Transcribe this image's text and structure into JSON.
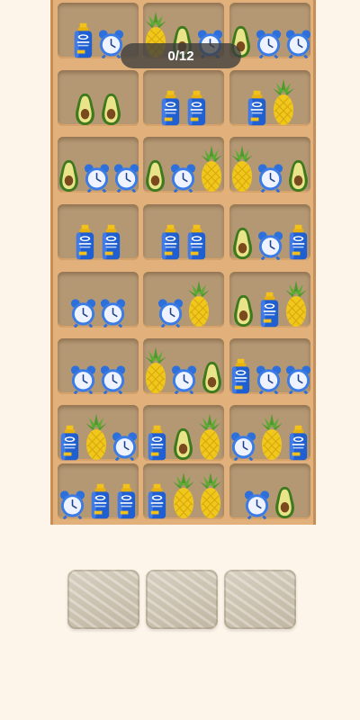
{
  "hud": {
    "progress_text": "0/12"
  },
  "colors": {
    "background": "#fdf5ea",
    "shelf_wood": "#e2b07a",
    "slot_back": "#b49874",
    "tray": "#d6cdbd"
  },
  "shelf": {
    "rows": [
      [
        [
          "sunscreen",
          "clock"
        ],
        [
          "pineapple",
          "avocado",
          "clock"
        ],
        [
          "avocado",
          "clock",
          "clock"
        ]
      ],
      [
        [
          "avocado",
          "avocado"
        ],
        [
          "sunscreen",
          "sunscreen"
        ],
        [
          "sunscreen",
          "pineapple"
        ]
      ],
      [
        [
          "avocado",
          "clock",
          "clock"
        ],
        [
          "avocado",
          "clock",
          "pineapple"
        ],
        [
          "pineapple",
          "clock",
          "avocado"
        ]
      ],
      [
        [
          "sunscreen",
          "sunscreen"
        ],
        [
          "sunscreen",
          "sunscreen"
        ],
        [
          "avocado",
          "clock",
          "sunscreen"
        ]
      ],
      [
        [
          "clock",
          "clock"
        ],
        [
          "clock",
          "pineapple"
        ],
        [
          "avocado",
          "sunscreen",
          "pineapple"
        ]
      ],
      [
        [
          "clock",
          "clock"
        ],
        [
          "pineapple",
          "clock",
          "avocado"
        ],
        [
          "sunscreen",
          "clock",
          "clock"
        ]
      ],
      [
        [
          "sunscreen",
          "pineapple",
          "clock"
        ],
        [
          "sunscreen",
          "avocado",
          "pineapple"
        ],
        [
          "clock",
          "pineapple",
          "sunscreen"
        ]
      ],
      [
        [
          "clock",
          "sunscreen",
          "sunscreen"
        ],
        [
          "sunscreen",
          "pineapple",
          "pineapple"
        ],
        [
          "clock",
          "avocado"
        ]
      ]
    ]
  },
  "trays": [
    {
      "id": "tray-1",
      "item": ""
    },
    {
      "id": "tray-2",
      "item": ""
    },
    {
      "id": "tray-3",
      "item": ""
    }
  ]
}
